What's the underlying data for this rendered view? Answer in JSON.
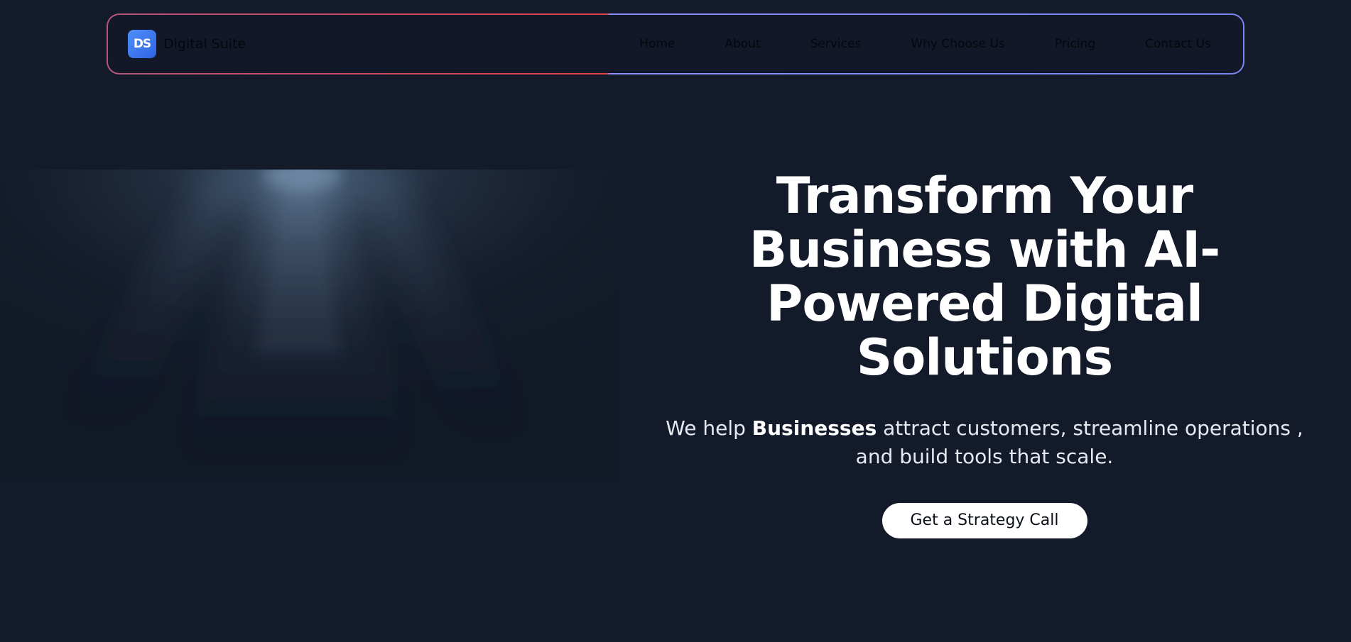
{
  "brand": {
    "badge": "DS",
    "name": "Digital Suite"
  },
  "nav": {
    "items": [
      {
        "label": "Home"
      },
      {
        "label": "About"
      },
      {
        "label": "Services"
      },
      {
        "label": "Why Choose Us"
      },
      {
        "label": "Pricing"
      },
      {
        "label": "Contact Us"
      }
    ]
  },
  "hero": {
    "title": "Transform Your Business with AI-Powered Digital Solutions",
    "subtitle_before": "We help ",
    "subtitle_bold": "Businesses",
    "subtitle_after": " attract customers, streamline operations , and build tools that scale.",
    "cta_label": "Get a Strategy Call"
  },
  "colors": {
    "background": "#131a2a",
    "nav_border_left": "#e1414a",
    "nav_border_right": "#7c86f0",
    "logo_badge": "#3b7bf0",
    "cta_background": "#ffffff"
  }
}
